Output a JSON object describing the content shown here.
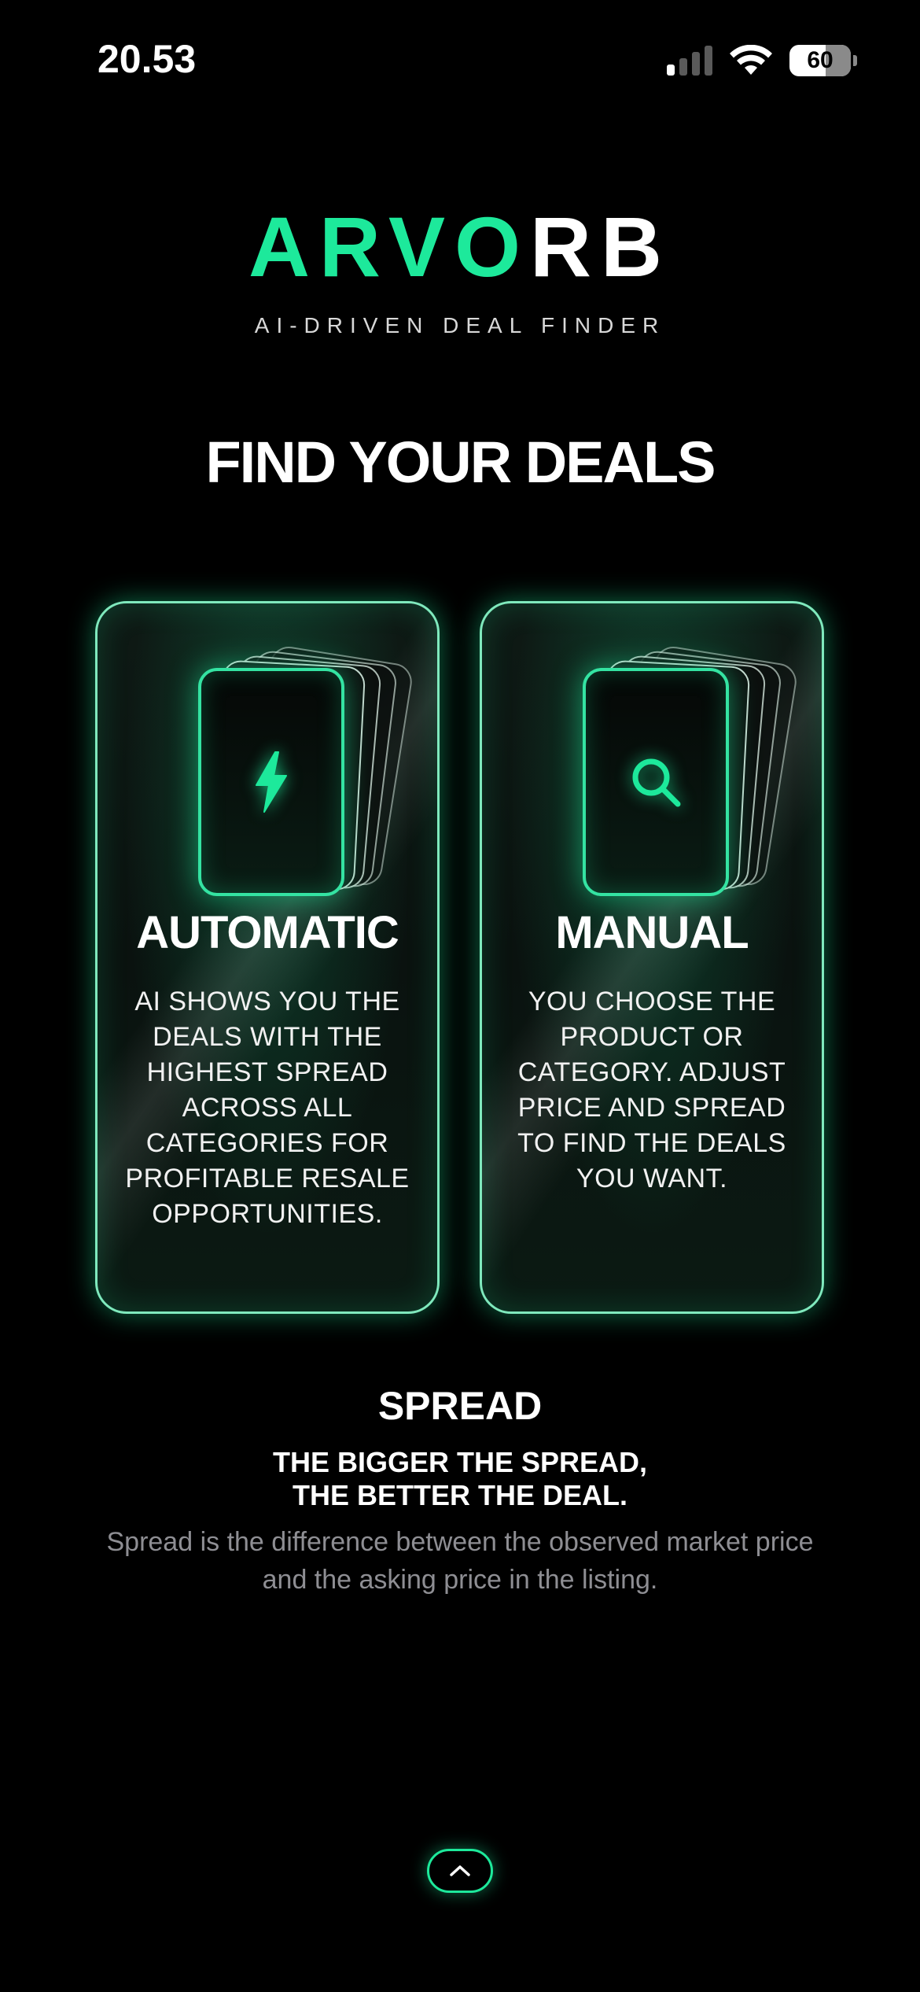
{
  "status_bar": {
    "time": "20.53",
    "battery": "60",
    "icons": [
      "cellular-signal-icon",
      "wifi-icon",
      "battery-icon"
    ]
  },
  "brand": {
    "name_green": "ARVO",
    "name_white": "RB",
    "tagline": "AI-DRIVEN DEAL FINDER"
  },
  "headline": "FIND YOUR DEALS",
  "cards": [
    {
      "title": "AUTOMATIC",
      "icon": "lightning-bolt-icon",
      "description": "AI SHOWS YOU THE DEALS WITH THE HIGHEST SPREAD ACROSS ALL CATEGORIES FOR PROFITABLE RESALE OPPORTUNITIES."
    },
    {
      "title": "MANUAL",
      "icon": "search-icon",
      "description": "YOU CHOOSE THE PRODUCT OR CATEGORY. ADJUST PRICE AND SPREAD TO FIND THE DEALS YOU WANT."
    }
  ],
  "spread": {
    "title": "SPREAD",
    "subtitle_line1": "THE BIGGER THE SPREAD,",
    "subtitle_line2": "THE BETTER THE DEAL.",
    "description": "Spread is the difference between the observed market price and the asking price in the listing."
  },
  "bottom_button": {
    "icon": "chevron-up-icon"
  },
  "colors": {
    "accent": "#1de99b",
    "background": "#000000",
    "muted_text": "#8e8e93"
  }
}
